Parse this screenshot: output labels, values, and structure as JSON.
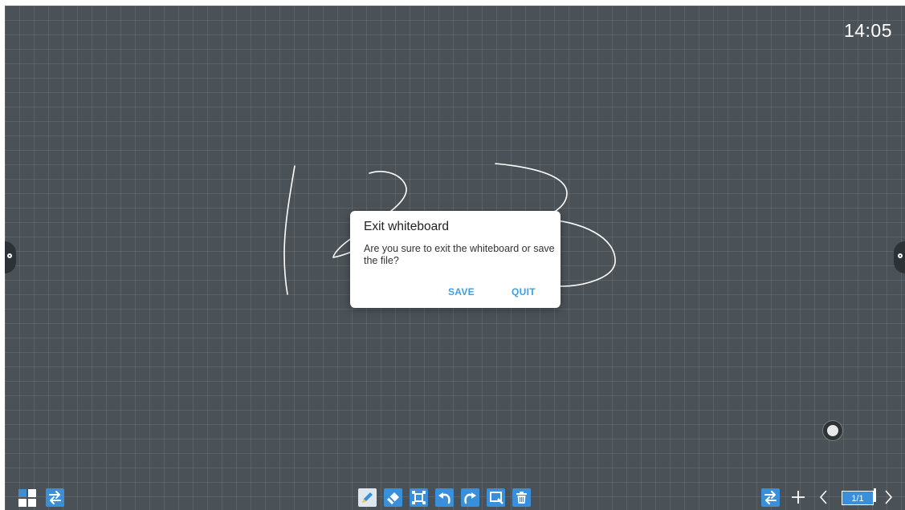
{
  "clock": "14:05",
  "dialog": {
    "title": "Exit whiteboard",
    "message": "Are you sure to exit the whiteboard or save the file?",
    "save_label": "SAVE",
    "quit_label": "QUIT"
  },
  "pagination": {
    "indicator": "1/1"
  },
  "colors": {
    "board": "#4b5257",
    "accent": "#3a8fdb",
    "dialog_button": "#3aa0e8"
  },
  "icons": {
    "left_toolbar": [
      "apps-grid-icon",
      "swap-arrows-icon"
    ],
    "center_toolbar": [
      "pen-icon",
      "eraser-icon",
      "select-icon",
      "undo-icon",
      "redo-icon",
      "screenshot-icon",
      "trash-icon"
    ],
    "right_toolbar": [
      "swap-arrows-icon",
      "plus-icon",
      "chevron-left-icon",
      "chevron-right-icon"
    ]
  }
}
